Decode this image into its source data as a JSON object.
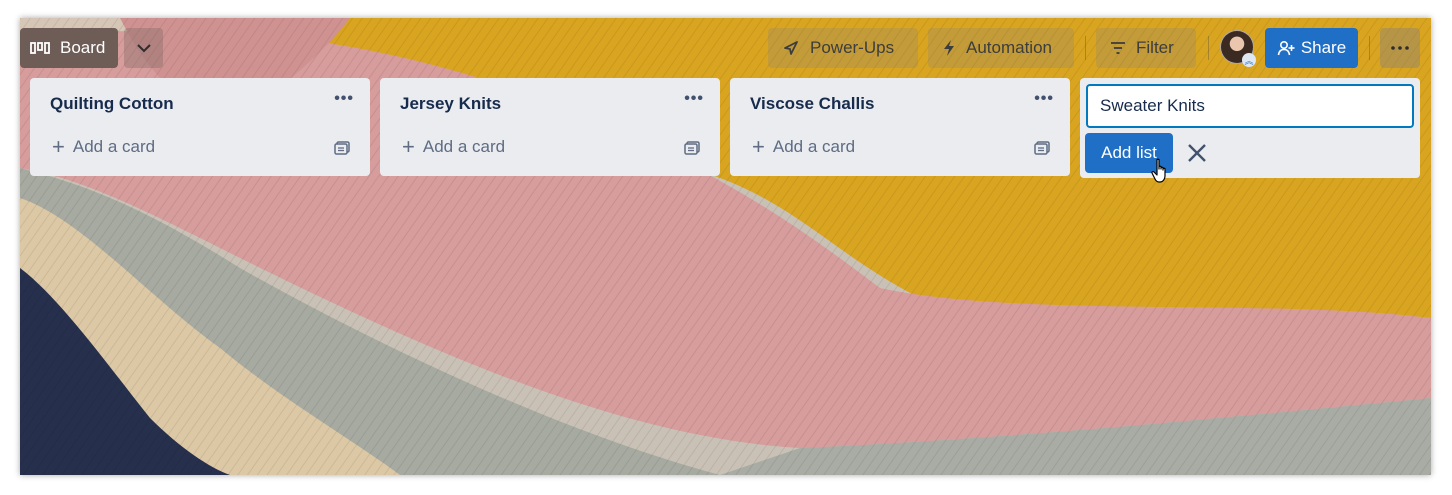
{
  "header": {
    "board_label": "Board",
    "powerups_label": "Power-Ups",
    "automation_label": "Automation",
    "filter_label": "Filter",
    "share_label": "Share"
  },
  "lists": [
    {
      "title": "Quilting Cotton",
      "add_card_label": "Add a card"
    },
    {
      "title": "Jersey Knits",
      "add_card_label": "Add a card"
    },
    {
      "title": "Viscose Challis",
      "add_card_label": "Add a card"
    }
  ],
  "add_list": {
    "input_value": "Sweater Knits",
    "button_label": "Add list"
  },
  "colors": {
    "primary_button": "#1f6fc6",
    "list_background": "#ebecf0",
    "board_button": "#6e5d56"
  },
  "icons": {
    "board": "board-icon",
    "chevron": "chevron-down-icon",
    "powerups": "rocket-icon",
    "automation": "bolt-icon",
    "filter": "filter-icon",
    "share": "add-user-icon",
    "more": "more-icon",
    "list_menu": "ellipsis-icon",
    "add": "plus-icon",
    "template": "card-template-icon",
    "close": "close-icon",
    "cursor": "hand-pointer-icon"
  }
}
